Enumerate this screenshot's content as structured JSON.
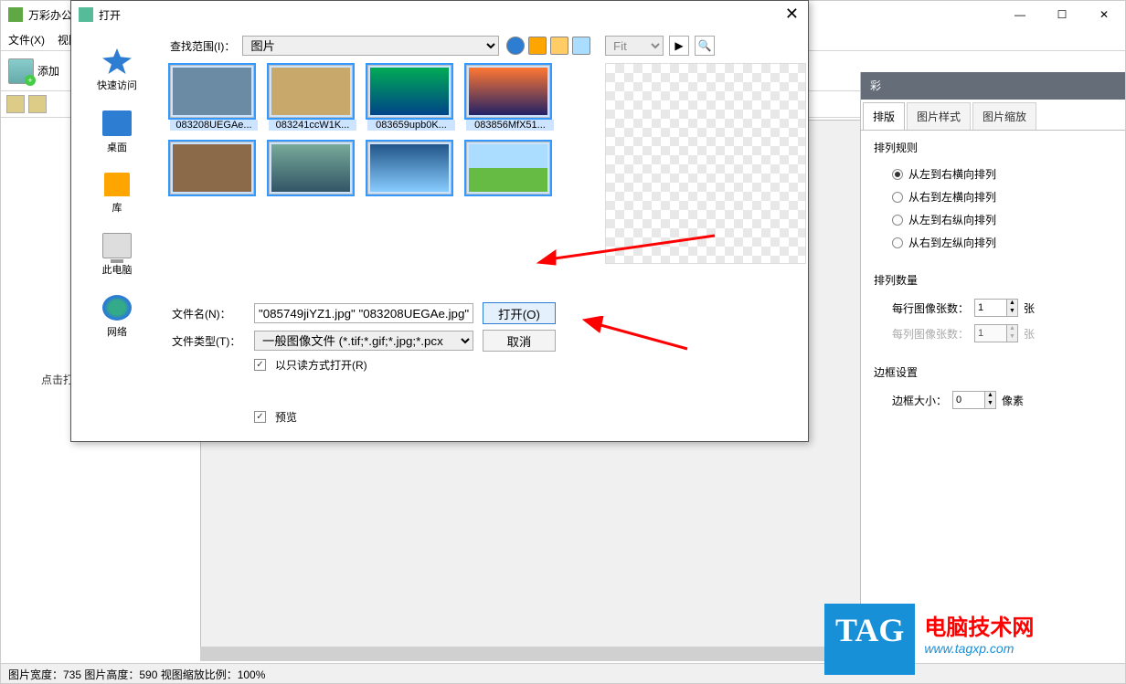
{
  "app": {
    "title_partial": "万彩办公",
    "menu": {
      "file": "文件(X)",
      "view_partial": "视图"
    },
    "toolbar": {
      "add_partial": "添加"
    }
  },
  "window_controls": {
    "min": "—",
    "max": "☐",
    "close": "✕"
  },
  "dialog": {
    "title": "打开",
    "lookup_label": "查找范围(I)：",
    "lookup_value": "图片",
    "nav": {
      "quick": "快速访问",
      "desktop": "桌面",
      "library": "库",
      "thispc": "此电脑",
      "network": "网络"
    },
    "files": [
      {
        "name": "083208UEGAe...",
        "selected": true
      },
      {
        "name": "083241ccW1K...",
        "selected": true
      },
      {
        "name": "083659upb0K...",
        "selected": true
      },
      {
        "name": "083856MfX51...",
        "selected": true
      },
      {
        "name": "",
        "selected": true
      },
      {
        "name": "",
        "selected": true
      },
      {
        "name": "",
        "selected": true
      },
      {
        "name": "",
        "selected": true
      }
    ],
    "fit": "Fit",
    "filename_label": "文件名(N)：",
    "filename_value": "\"085749jiYZ1.jpg\" \"083208UEGAe.jpg\" \"",
    "filetype_label": "文件类型(T)：",
    "filetype_value": "一般图像文件 (*.tif;*.gif;*.jpg;*.pcx",
    "readonly_label": "以只读方式打开(R)",
    "preview_checkbox": "预览",
    "open_btn": "打开(O)",
    "cancel_btn": "取消"
  },
  "right_panel": {
    "crumb_partial": "彩",
    "tabs": {
      "layout": "排版",
      "style": "图片样式",
      "zoom": "图片缩放"
    },
    "rules": {
      "title": "排列规则",
      "opt1": "从左到右横向排列",
      "opt2": "从右到左横向排列",
      "opt3": "从左到右纵向排列",
      "opt4": "从右到左纵向排列"
    },
    "count": {
      "title": "排列数量",
      "row_label": "每行图像张数：",
      "row_val": "1",
      "row_unit": "张",
      "col_label": "每列图像张数：",
      "col_val": "1",
      "col_unit": "张"
    },
    "border": {
      "title": "边框设置",
      "size_label": "边框大小：",
      "size_val": "0",
      "unit": "像素"
    }
  },
  "status": {
    "text": "图片宽度：735   图片高度：590   视图缩放比例：100%"
  },
  "hint": "点击打",
  "watermark": {
    "tag": "TAG",
    "line1": "电脑技术网",
    "line2": "www.tagxp.com"
  }
}
